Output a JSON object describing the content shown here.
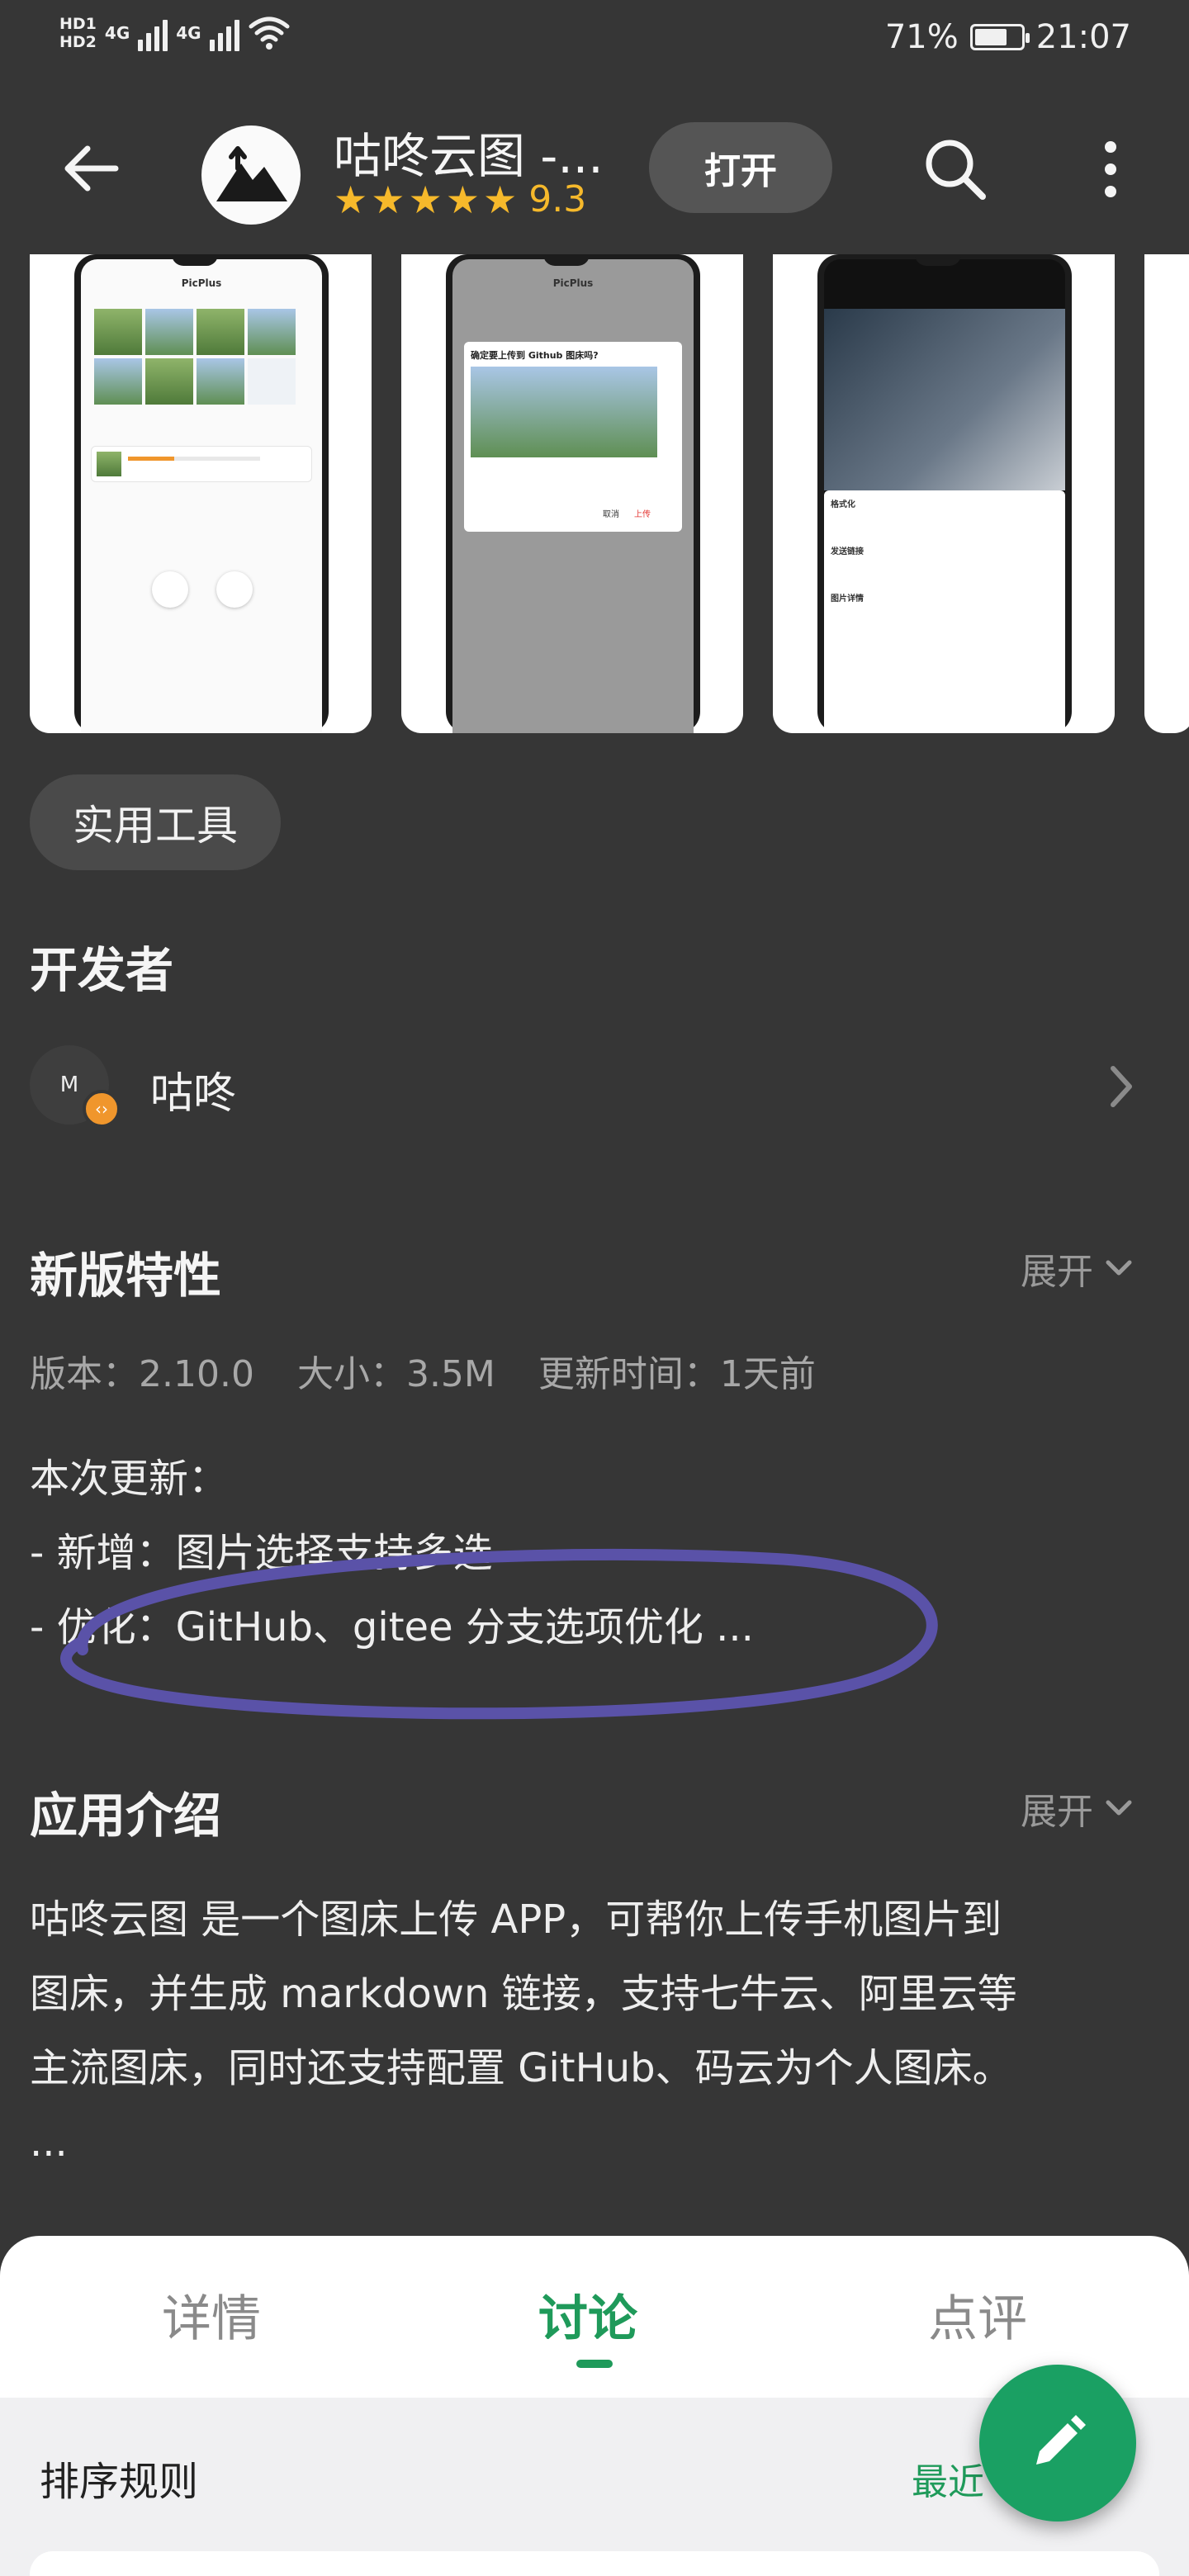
{
  "status_bar": {
    "hd1": "HD1",
    "hd2": "HD2",
    "net1": "4G",
    "net2": "4G",
    "battery": "71%",
    "battery_level": 0.71,
    "time": "21:07"
  },
  "header": {
    "app_title": "咕咚云图 -...",
    "rating_value": "9.3",
    "stars": 5,
    "open_label": "打开",
    "icons": [
      "back-arrow-icon",
      "search-icon",
      "more-vertical-icon"
    ]
  },
  "screenshots": [
    {
      "app_name": "PicPlus",
      "caption": ""
    },
    {
      "app_name": "PicPlus",
      "dialog_title": "确定要上传到 Github 图床吗?",
      "cancel": "取消",
      "confirm": "上传"
    },
    {
      "section1": "格式化",
      "section2": "发送链接",
      "section3": "图片详情"
    }
  ],
  "tag": "实用工具",
  "developer": {
    "heading": "开发者",
    "avatar_letter": "M",
    "name": "咕咚"
  },
  "whats_new": {
    "heading": "新版特性",
    "expand": "展开",
    "version": "版本：2.10.0",
    "size": "大小：3.5M",
    "updated": "更新时间：1天前",
    "lines": [
      "本次更新：",
      "- 新增：图片选择支持多选",
      "- 优化：GitHub、gitee 分支选项优化 ..."
    ]
  },
  "intro": {
    "heading": "应用介绍",
    "expand": "展开",
    "lines": [
      "咕咚云图 是一个图床上传 APP，可帮你上传手机图片到",
      "图床，并生成 markdown 链接，支持七牛云、阿里云等",
      "主流图床，同时还支持配置 GitHub、码云为个人图床。",
      "..."
    ]
  },
  "tabs": [
    {
      "label": "详情",
      "active": false
    },
    {
      "label": "讨论",
      "active": true
    },
    {
      "label": "点评",
      "active": false
    }
  ],
  "sort": {
    "label": "排序规则",
    "value": "最近"
  },
  "colors": {
    "accent": "#1f9a5a",
    "star": "#f6b92b",
    "annotation": "#5a52a8"
  }
}
